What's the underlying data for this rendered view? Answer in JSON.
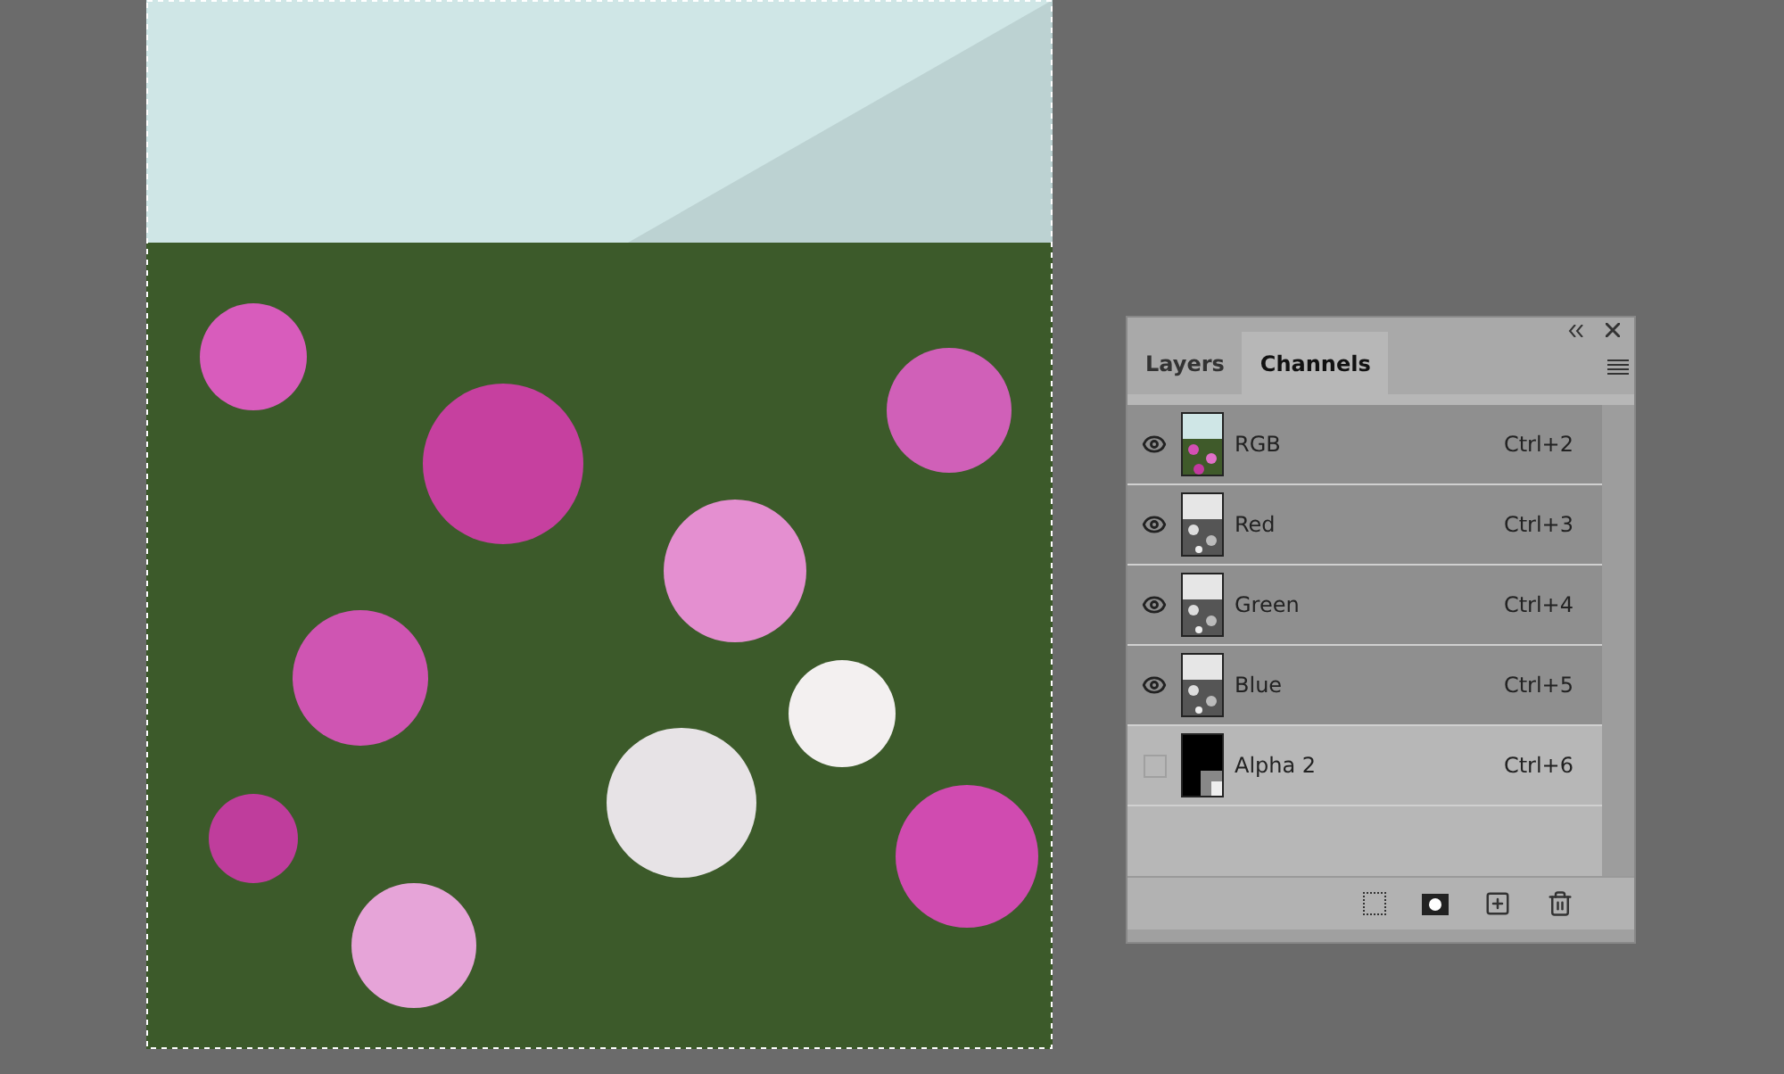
{
  "panel": {
    "tabs": [
      {
        "label": "Layers",
        "selected": false
      },
      {
        "label": "Channels",
        "selected": true
      }
    ],
    "channels": [
      {
        "name": "RGB",
        "shortcut": "Ctrl+2",
        "visible": true,
        "selected": true,
        "kind": "composite"
      },
      {
        "name": "Red",
        "shortcut": "Ctrl+3",
        "visible": true,
        "selected": true,
        "kind": "gray"
      },
      {
        "name": "Green",
        "shortcut": "Ctrl+4",
        "visible": true,
        "selected": true,
        "kind": "gray"
      },
      {
        "name": "Blue",
        "shortcut": "Ctrl+5",
        "visible": true,
        "selected": true,
        "kind": "gray"
      },
      {
        "name": "Alpha 2",
        "shortcut": "Ctrl+6",
        "visible": false,
        "selected": false,
        "kind": "alpha"
      }
    ]
  }
}
